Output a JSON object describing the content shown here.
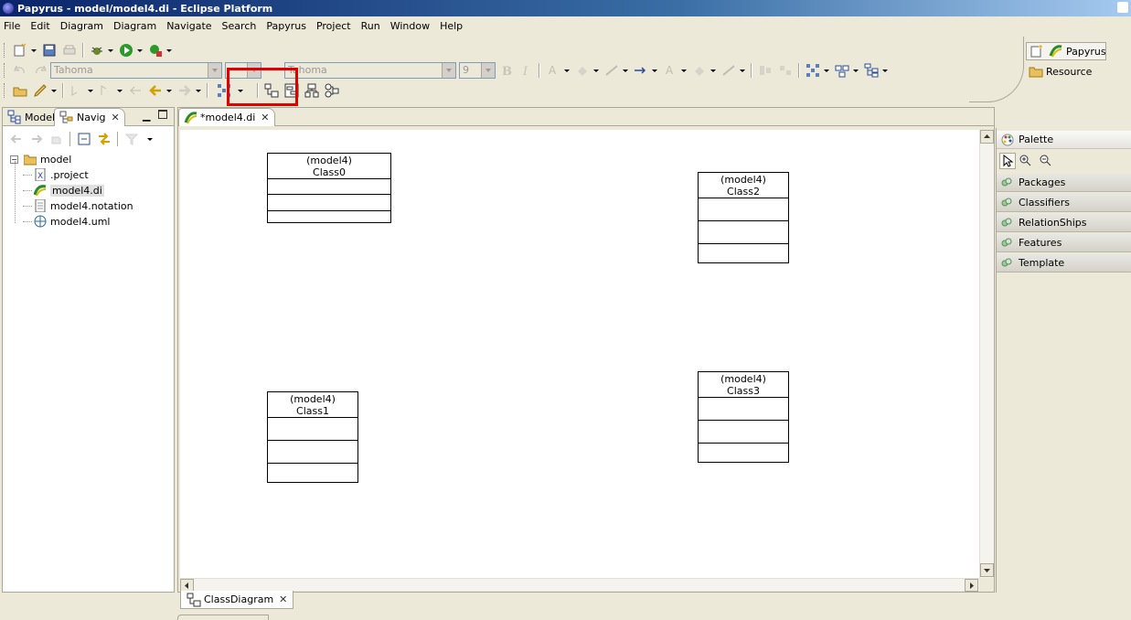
{
  "window": {
    "title": "Papyrus - model/model4.di - Eclipse Platform"
  },
  "menu": [
    "File",
    "Edit",
    "Diagram",
    "Diagram",
    "Navigate",
    "Search",
    "Papyrus",
    "Project",
    "Run",
    "Window",
    "Help"
  ],
  "toolbar": {
    "font_family": "Tahoma",
    "font_family_2": "Tahoma",
    "font_size": "9"
  },
  "perspectives": {
    "papyrus": "Papyrus",
    "resource": "Resource"
  },
  "left_view": {
    "tabs": [
      "Model",
      "Navig"
    ],
    "tree": {
      "root": "model",
      "children": [
        ".project",
        "model4.di",
        "model4.notation",
        "model4.uml"
      ]
    }
  },
  "editor": {
    "tab": "*model4.di",
    "bottom_tab": "ClassDiagram",
    "classes": [
      {
        "stereo": "(model4)",
        "name": "Class0"
      },
      {
        "stereo": "(model4)",
        "name": "Class1"
      },
      {
        "stereo": "(model4)",
        "name": "Class2"
      },
      {
        "stereo": "(model4)",
        "name": "Class3"
      }
    ]
  },
  "palette": {
    "title": "Palette",
    "drawers": [
      "Packages",
      "Classifiers",
      "RelationShips",
      "Features",
      "Template"
    ]
  },
  "colors": {
    "highlight": "#e00000",
    "titlebar": "#0a246a"
  }
}
